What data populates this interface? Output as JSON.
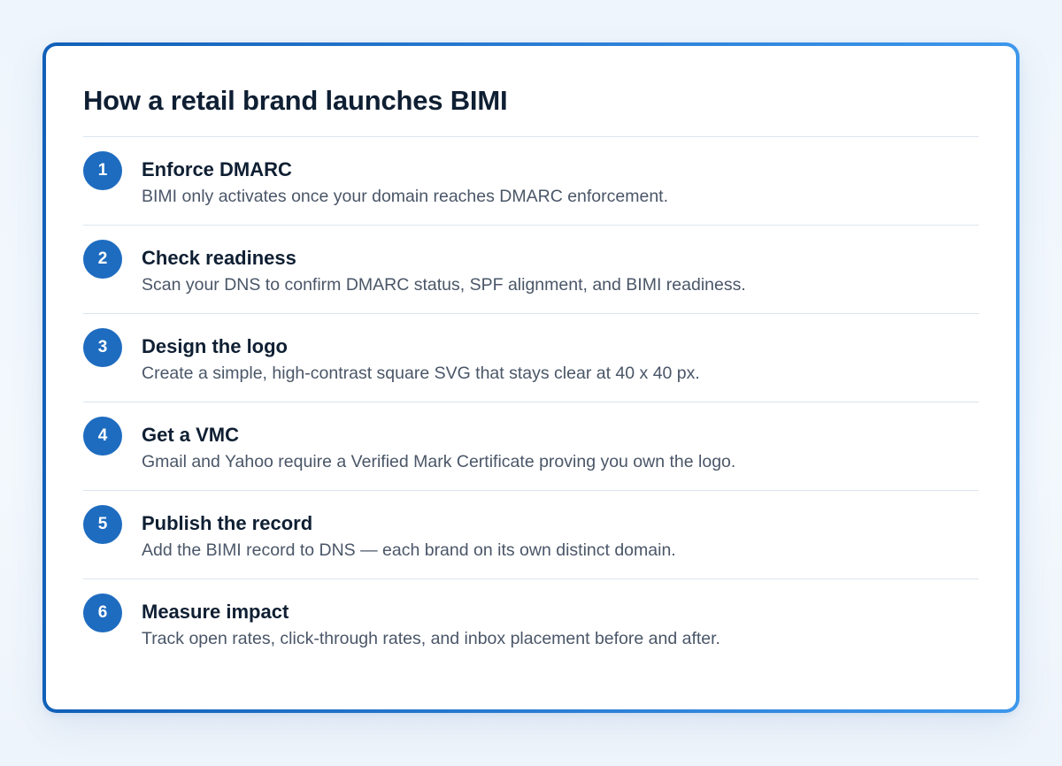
{
  "title": "How a retail brand launches BIMI",
  "steps": [
    {
      "number": "1",
      "title": "Enforce DMARC",
      "description": "BIMI only activates once your domain reaches DMARC enforcement."
    },
    {
      "number": "2",
      "title": "Check readiness",
      "description": "Scan your DNS to confirm DMARC status, SPF alignment, and BIMI readiness."
    },
    {
      "number": "3",
      "title": "Design the logo",
      "description": "Create a simple, high-contrast square SVG that stays clear at 40 x 40 px."
    },
    {
      "number": "4",
      "title": "Get a VMC",
      "description": "Gmail and Yahoo require a Verified Mark Certificate proving you own the logo."
    },
    {
      "number": "5",
      "title": "Publish the record",
      "description": "Add the BIMI record to DNS — each brand on its own distinct domain."
    },
    {
      "number": "6",
      "title": "Measure impact",
      "description": "Track open rates, click-through rates, and inbox placement before and after."
    }
  ],
  "colors": {
    "accent": "#1e6cc0",
    "border_gradient_start": "#1160b8",
    "border_gradient_end": "#3d97ec",
    "heading_text": "#0f1f33",
    "body_text": "#4a5668",
    "divider": "#dbe5ef"
  }
}
